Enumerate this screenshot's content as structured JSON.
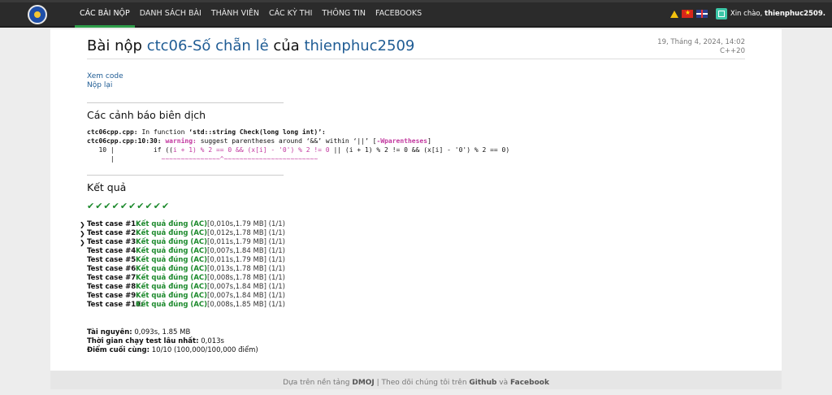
{
  "nav": {
    "items": [
      "CÁC BÀI NỘP",
      "DANH SÁCH BÀI",
      "THÀNH VIÊN",
      "CÁC KỲ THI",
      "THÔNG TIN",
      "FACEBOOKS"
    ],
    "greeting": "Xin chào,",
    "username": "thienphuc2509."
  },
  "header": {
    "prefix": "Bài nộp",
    "problem": "ctc06-Số chẵn lẻ",
    "mid": "của",
    "user": "thienphuc2509",
    "date": "19, Tháng 4, 2024, 14:02",
    "language": "C++20"
  },
  "links": {
    "view_code": "Xem code",
    "resubmit": "Nộp lại"
  },
  "warnings": {
    "heading": "Các cảnh báo biên dịch",
    "line1_file": "ctc06cpp.cpp:",
    "line1_rest": " In function ",
    "line1_sig": "‘std::string Check(long long int)’:",
    "line2_loc": "ctc06cpp.cpp:10:30:",
    "line2_warn": "warning:",
    "line2_msg": " suggest parentheses around ‘&&’ within ‘||’ [",
    "line2_flag": "-Wparentheses",
    "line2_end": "]",
    "line3_num": "   10 |",
    "line3_code_a": "          if ((",
    "line3_code_hl": "i + 1) % 2 == 0 && (x[i] - '0') % 2 != 0",
    "line3_code_b": " || (i + 1) % 2 != 0 && (x[i] - '0') % 2 == 0)",
    "line4_pipe": "      |",
    "line4_squig": "            ~~~~~~~~~~~~~~~^~~~~~~~~~~~~~~~~~~~~~~~~"
  },
  "results": {
    "heading": "Kết quả",
    "checks": "✔✔✔✔✔✔✔✔✔✔",
    "cases": [
      {
        "label": "Test case #1:",
        "result": "Kết quả đúng (AC)",
        "stats": " [0,010s,1.79 MB] (1/1)",
        "expandable": true
      },
      {
        "label": "Test case #2:",
        "result": "Kết quả đúng (AC)",
        "stats": " [0,012s,1.78 MB] (1/1)",
        "expandable": true
      },
      {
        "label": "Test case #3:",
        "result": "Kết quả đúng (AC)",
        "stats": " [0,011s,1.79 MB] (1/1)",
        "expandable": true
      },
      {
        "label": "Test case #4:",
        "result": "Kết quả đúng (AC)",
        "stats": " [0,007s,1.84 MB] (1/1)",
        "expandable": false
      },
      {
        "label": "Test case #5:",
        "result": "Kết quả đúng (AC)",
        "stats": " [0,011s,1.79 MB] (1/1)",
        "expandable": false
      },
      {
        "label": "Test case #6:",
        "result": "Kết quả đúng (AC)",
        "stats": " [0,013s,1.78 MB] (1/1)",
        "expandable": false
      },
      {
        "label": "Test case #7:",
        "result": "Kết quả đúng (AC)",
        "stats": " [0,008s,1.78 MB] (1/1)",
        "expandable": false
      },
      {
        "label": "Test case #8:",
        "result": "Kết quả đúng (AC)",
        "stats": " [0,007s,1.84 MB] (1/1)",
        "expandable": false
      },
      {
        "label": "Test case #9:",
        "result": "Kết quả đúng (AC)",
        "stats": " [0,007s,1.84 MB] (1/1)",
        "expandable": false
      },
      {
        "label": "Test case #10:",
        "result": "Kết quả đúng (AC)",
        "stats": " [0,008s,1.85 MB] (1/1)",
        "expandable": false
      }
    ]
  },
  "summary": {
    "resources_label": "Tài nguyên:",
    "resources_value": " 0,093s, 1.85 MB",
    "max_time_label": "Thời gian chạy test lâu nhất:",
    "max_time_value": " 0,013s",
    "score_label": "Điểm cuối cùng:",
    "score_value": " 10/10 (100,000/100,000 điểm)"
  },
  "footer": {
    "text_a": "Dựa trên nền tảng ",
    "dmoj": "DMOJ",
    "text_b": " | Theo dõi chúng tôi trên ",
    "github": "Github",
    "text_c": " và ",
    "facebook": "Facebook"
  },
  "colors": {
    "accent_green": "#1d8a2d",
    "link_blue": "#1f5c94",
    "warning_magenta": "#c2389f",
    "topbar": "#2b2b2b"
  }
}
